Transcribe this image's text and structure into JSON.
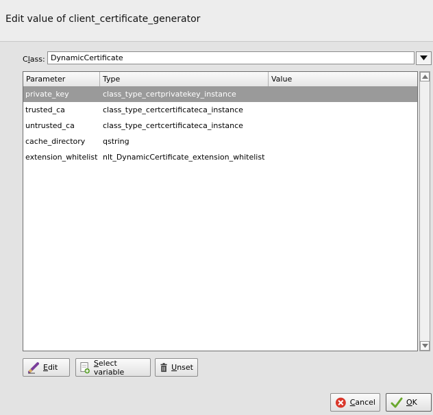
{
  "dialog": {
    "title": "Edit value of client_certificate_generator"
  },
  "class_selector": {
    "label": "Class:",
    "label_pre": "C",
    "label_mnemonic": "l",
    "label_post": "ass:",
    "value": "DynamicCertificate"
  },
  "table": {
    "headers": [
      "Parameter",
      "Type",
      "Value"
    ],
    "rows": [
      {
        "parameter": "private_key",
        "type": "class_type_certprivatekey_instance",
        "value": ""
      },
      {
        "parameter": "trusted_ca",
        "type": "class_type_certcertificateca_instance",
        "value": ""
      },
      {
        "parameter": "untrusted_ca",
        "type": "class_type_certcertificateca_instance",
        "value": ""
      },
      {
        "parameter": "cache_directory",
        "type": "qstring",
        "value": ""
      },
      {
        "parameter": "extension_whitelist",
        "type": "nlt_DynamicCertificate_extension_whitelist",
        "value": ""
      }
    ],
    "selected_row": 0
  },
  "buttons": {
    "edit": {
      "mnemonic": "E",
      "rest": "dit",
      "icon": "pencil-icon"
    },
    "select_variable": {
      "mnemonic": "S",
      "rest": "elect variable",
      "icon": "variable-icon"
    },
    "unset": {
      "mnemonic": "U",
      "rest": "nset",
      "icon": "trash-icon"
    },
    "cancel": {
      "mnemonic": "C",
      "rest": "ancel",
      "icon": "cancel-icon"
    },
    "ok": {
      "mnemonic": "O",
      "rest": "K",
      "icon": "checkmark-icon"
    }
  },
  "colors": {
    "selection": "#9a9a9a",
    "cancel_icon": "#d9372b",
    "ok_icon": "#6aa82f"
  }
}
